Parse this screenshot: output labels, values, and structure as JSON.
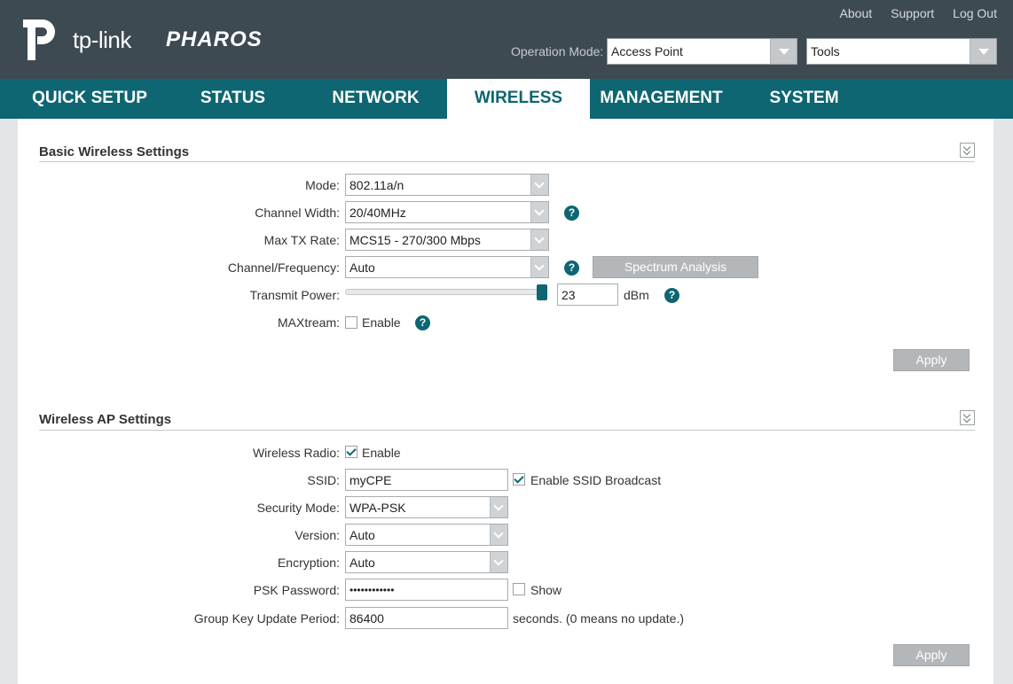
{
  "header": {
    "brand": "tp-link",
    "product": "PHAROS",
    "links": [
      "About",
      "Support",
      "Log Out"
    ],
    "operation_mode_label": "Operation Mode:",
    "operation_mode_value": "Access Point",
    "tools_value": "Tools"
  },
  "nav": {
    "items": [
      "QUICK SETUP",
      "STATUS",
      "NETWORK",
      "WIRELESS",
      "MANAGEMENT",
      "SYSTEM"
    ],
    "active": "WIRELESS"
  },
  "basic": {
    "title": "Basic Wireless Settings",
    "mode_label": "Mode:",
    "mode_value": "802.11a/n",
    "channel_width_label": "Channel Width:",
    "channel_width_value": "20/40MHz",
    "max_tx_label": "Max TX Rate:",
    "max_tx_value": "MCS15 - 270/300 Mbps",
    "channel_label": "Channel/Frequency:",
    "channel_value": "Auto",
    "spectrum_button": "Spectrum Analysis",
    "power_label": "Transmit Power:",
    "power_value": "23",
    "power_level_fraction": 1.0,
    "power_unit": "dBm",
    "maxtream_label": "MAXtream:",
    "maxtream_enable": "Enable",
    "maxtream_checked": false,
    "apply": "Apply"
  },
  "ap": {
    "title": "Wireless AP Settings",
    "radio_label": "Wireless Radio:",
    "radio_enable": "Enable",
    "radio_checked": true,
    "ssid_label": "SSID:",
    "ssid_value": "myCPE",
    "ssid_broadcast": "Enable SSID Broadcast",
    "ssid_broadcast_checked": true,
    "security_label": "Security Mode:",
    "security_value": "WPA-PSK",
    "version_label": "Version:",
    "version_value": "Auto",
    "encryption_label": "Encryption:",
    "encryption_value": "Auto",
    "psk_label": "PSK Password:",
    "psk_value": "••••••••••••",
    "psk_show": "Show",
    "psk_show_checked": false,
    "gkup_label": "Group Key Update Period:",
    "gkup_value": "86400",
    "gkup_note": "seconds. (0 means no update.)",
    "apply": "Apply"
  },
  "colors": {
    "header_bg": "#3e4a52",
    "nav_bg": "#0d6672",
    "accent": "#0d6672",
    "button_bg": "#b3b7ba"
  },
  "icons": {
    "help": "?",
    "collapse": "double-chevron-down-icon"
  }
}
